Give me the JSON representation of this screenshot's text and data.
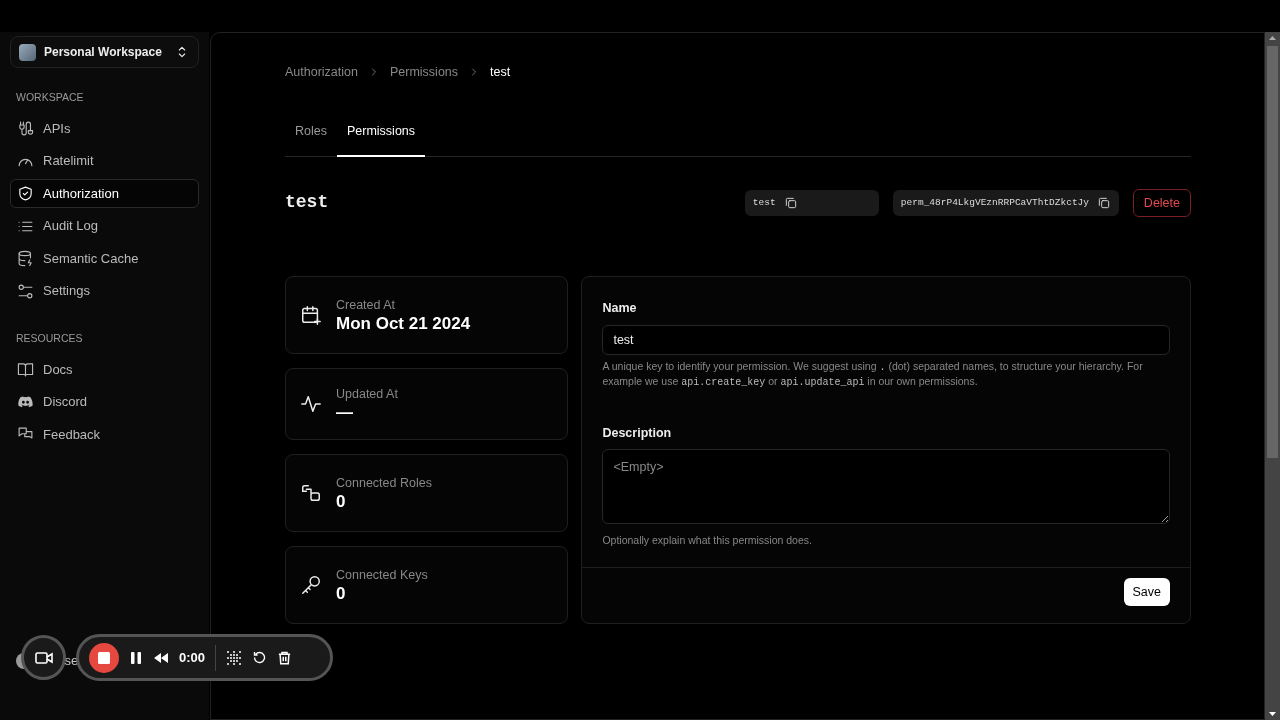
{
  "workspace": {
    "name": "Personal Workspace"
  },
  "sidebar": {
    "sections": [
      {
        "title": "WORKSPACE",
        "items": [
          {
            "label": "APIs",
            "selected": false
          },
          {
            "label": "Ratelimit",
            "selected": false
          },
          {
            "label": "Authorization",
            "selected": true
          },
          {
            "label": "Audit Log",
            "selected": false
          },
          {
            "label": "Semantic Cache",
            "selected": false
          },
          {
            "label": "Settings",
            "selected": false
          }
        ]
      },
      {
        "title": "RESOURCES",
        "items": [
          {
            "label": "Docs",
            "selected": false
          },
          {
            "label": "Discord",
            "selected": false
          },
          {
            "label": "Feedback",
            "selected": false
          }
        ]
      }
    ],
    "user_label": "se"
  },
  "breadcrumb": [
    "Authorization",
    "Permissions",
    "test"
  ],
  "tabs": [
    {
      "label": "Roles",
      "selected": false
    },
    {
      "label": "Permissions",
      "selected": true
    }
  ],
  "title": "test",
  "copy_fields": [
    "test",
    "perm_48rP4LkgVEznRRPCaVThtDZkctJy"
  ],
  "delete_button": "Delete",
  "stats": [
    {
      "label": "Created At",
      "value": "Mon Oct 21 2024"
    },
    {
      "label": "Updated At",
      "value": "—"
    },
    {
      "label": "Connected Roles",
      "value": "0"
    },
    {
      "label": "Connected Keys",
      "value": "0"
    }
  ],
  "form": {
    "name_label": "Name",
    "name_value": "test",
    "name_help": [
      {
        "text": "A unique key to identify your permission. We suggest using "
      },
      {
        "text": ".",
        "kind": "code"
      },
      {
        "text": " (dot) separated names, to structure your hierarchy. For example we use "
      },
      {
        "text": "api.create_key",
        "kind": "code"
      },
      {
        "text": " or "
      },
      {
        "text": "api.update_api",
        "kind": "code"
      },
      {
        "text": " in our own permissions."
      }
    ],
    "description_label": "Description",
    "description_placeholder": "<Empty>",
    "description_help": "Optionally explain what this permission does.",
    "save_button": "Save"
  },
  "recorder": {
    "time": "0:00"
  }
}
